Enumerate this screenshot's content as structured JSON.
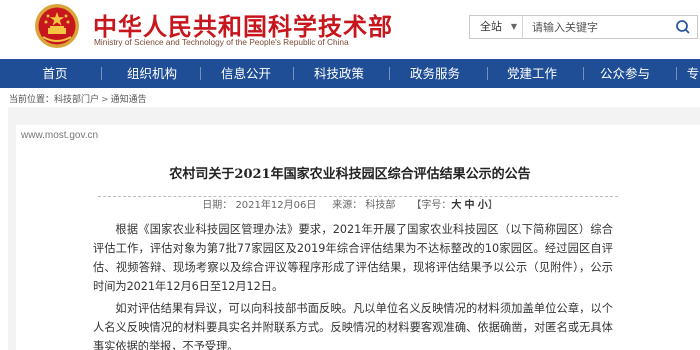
{
  "header": {
    "site_name": "中华人民共和国科学技术部",
    "site_name_en": "Ministry of Science and Technology of the People's Republic of China",
    "emblem_icon": "national-emblem-icon"
  },
  "search": {
    "scope": "全站",
    "placeholder": "请输入关键字",
    "icon": "search-icon"
  },
  "nav": {
    "items": [
      "首页",
      "组织机构",
      "信息公开",
      "科技政策",
      "政务服务",
      "党建工作",
      "公众参与",
      "专"
    ]
  },
  "breadcrumb": {
    "prefix": "当前位置：",
    "items": [
      "科技部门户",
      "通知通告"
    ],
    "separator": ">"
  },
  "site_url": "www.most.gov.cn",
  "article": {
    "title": "农村司关于2021年国家农业科技园区综合评估结果公示的公告",
    "date": "日期： 2021年12月06日",
    "source": "来源： 科技部",
    "font_size_label": "【字号：",
    "font_size_options": [
      "大",
      "中",
      "小"
    ],
    "font_size_close": "】",
    "paragraphs": [
      "根据《国家农业科技园区管理办法》要求，2021年开展了国家农业科技园区（以下简称园区）综合评估工作，评估对象为第7批77家园区及2019年综合评估结果为不达标整改的10家园区。经过园区自评估、视频答辩、现场考察以及综合评议等程序形成了评估结果，现将评估结果予以公示（见附件），公示时间为2021年12月6日至12月12日。",
      "如对评估结果有异议，可以向科技部书面反映。凡以单位名义反映情况的材料须加盖单位公章，以个人名义反映情况的材料要具实名并附联系方式。反映情况的材料要客观准确、依据确凿，对匿名或无具体事实依据的举报，不予受理。"
    ]
  },
  "colors": {
    "brand_red": "#c8161d",
    "nav_blue": "#1f4e96"
  }
}
